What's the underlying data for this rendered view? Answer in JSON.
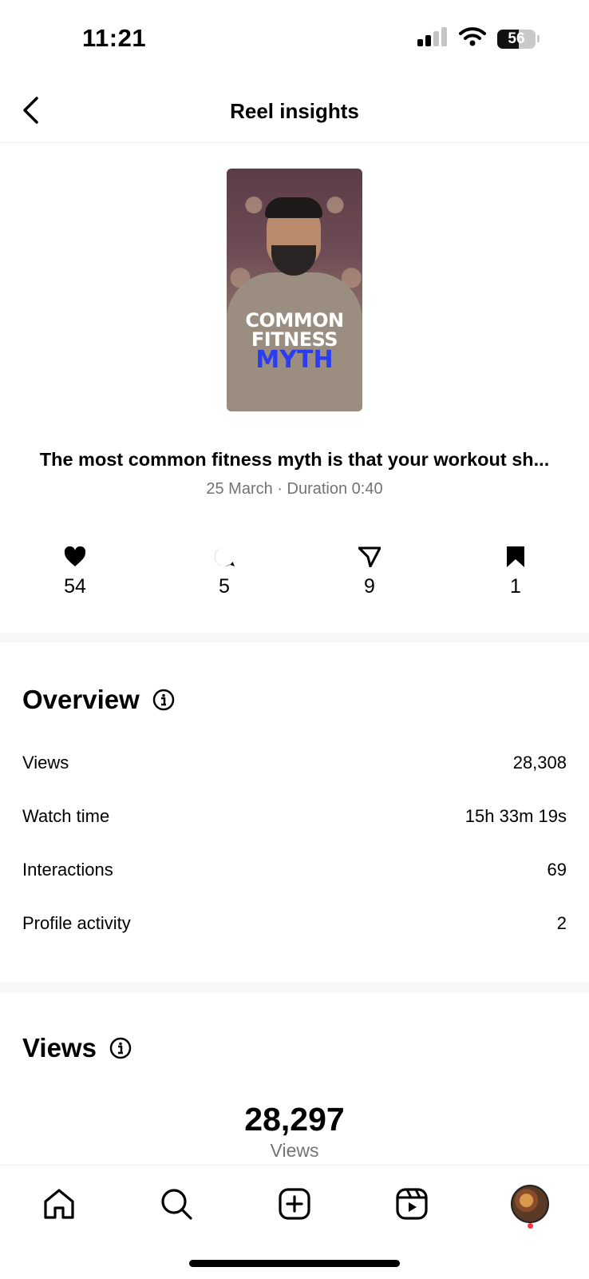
{
  "status_bar": {
    "time": "11:21",
    "battery": "56",
    "battery_level": 0.56
  },
  "header": {
    "title": "Reel insights"
  },
  "reel": {
    "thumbnail_text": [
      "COMMON",
      "FITNESS",
      "MYTH"
    ],
    "caption": "The most common fitness myth is that your workout sh...",
    "meta": "25 March · Duration 0:40"
  },
  "engagement": [
    {
      "icon": "heart-icon",
      "count": "54"
    },
    {
      "icon": "comment-icon",
      "count": "5"
    },
    {
      "icon": "send-icon",
      "count": "9"
    },
    {
      "icon": "bookmark-icon",
      "count": "1"
    }
  ],
  "overview": {
    "title": "Overview",
    "rows": [
      {
        "label": "Views",
        "value": "28,308"
      },
      {
        "label": "Watch time",
        "value": "15h 33m 19s"
      },
      {
        "label": "Interactions",
        "value": "69"
      },
      {
        "label": "Profile activity",
        "value": "2"
      }
    ]
  },
  "views_section": {
    "title": "Views",
    "total": "28,297",
    "label": "Views"
  },
  "tab_bar": [
    "home-icon",
    "search-icon",
    "create-icon",
    "reels-icon",
    "profile-avatar"
  ],
  "colors": {
    "accent_text": "#000000",
    "muted_text": "#737373",
    "notification": "#ff3040"
  }
}
